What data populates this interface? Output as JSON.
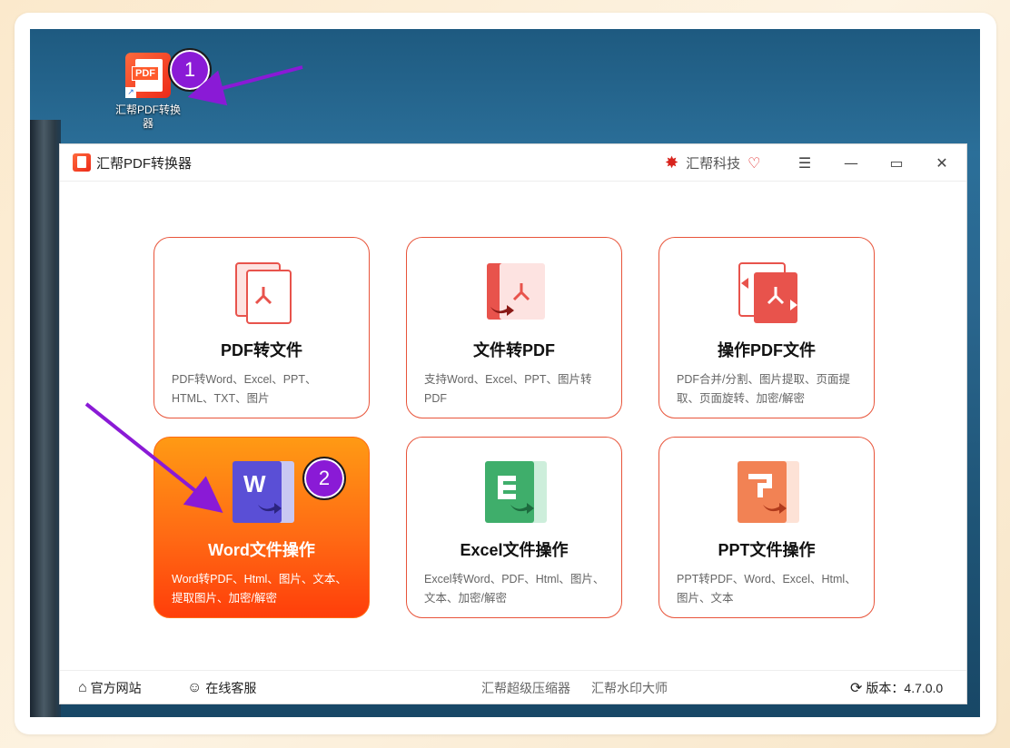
{
  "desktop": {
    "icon_label_line1": "汇帮PDF转换",
    "icon_label_line2": "器",
    "icon_badge": "PDF",
    "step1": "1",
    "step2": "2"
  },
  "window": {
    "title": "汇帮PDF转换器",
    "brand": "汇帮科技",
    "menu_glyph": "☰",
    "minimize_glyph": "—",
    "maximize_glyph": "▭",
    "close_glyph": "✕"
  },
  "cards": [
    {
      "title": "PDF转文件",
      "desc": "PDF转Word、Excel、PPT、HTML、TXT、图片"
    },
    {
      "title": "文件转PDF",
      "desc": "支持Word、Excel、PPT、图片转PDF"
    },
    {
      "title": "操作PDF文件",
      "desc": "PDF合并/分割、图片提取、页面提取、页面旋转、加密/解密"
    },
    {
      "title": "Word文件操作",
      "desc": "Word转PDF、Html、图片、文本、提取图片、加密/解密"
    },
    {
      "title": "Excel文件操作",
      "desc": "Excel转Word、PDF、Html、图片、文本、加密/解密"
    },
    {
      "title": "PPT文件操作",
      "desc": "PPT转PDF、Word、Excel、Html、图片、文本"
    }
  ],
  "footer": {
    "website": "官方网站",
    "support": "在线客服",
    "compressor": "汇帮超级压缩器",
    "watermark": "汇帮水印大师",
    "version": "版本：4.7.0.0"
  },
  "colors": {
    "accent": "#ff6a14",
    "card_border": "#e8543a",
    "step_badge": "#8a1ad6"
  },
  "icons": [
    "home-icon",
    "headset-icon",
    "refresh-icon",
    "menu-icon",
    "minimize-icon",
    "maximize-icon",
    "close-icon",
    "brand-logo-icon",
    "vip-heart-icon"
  ]
}
